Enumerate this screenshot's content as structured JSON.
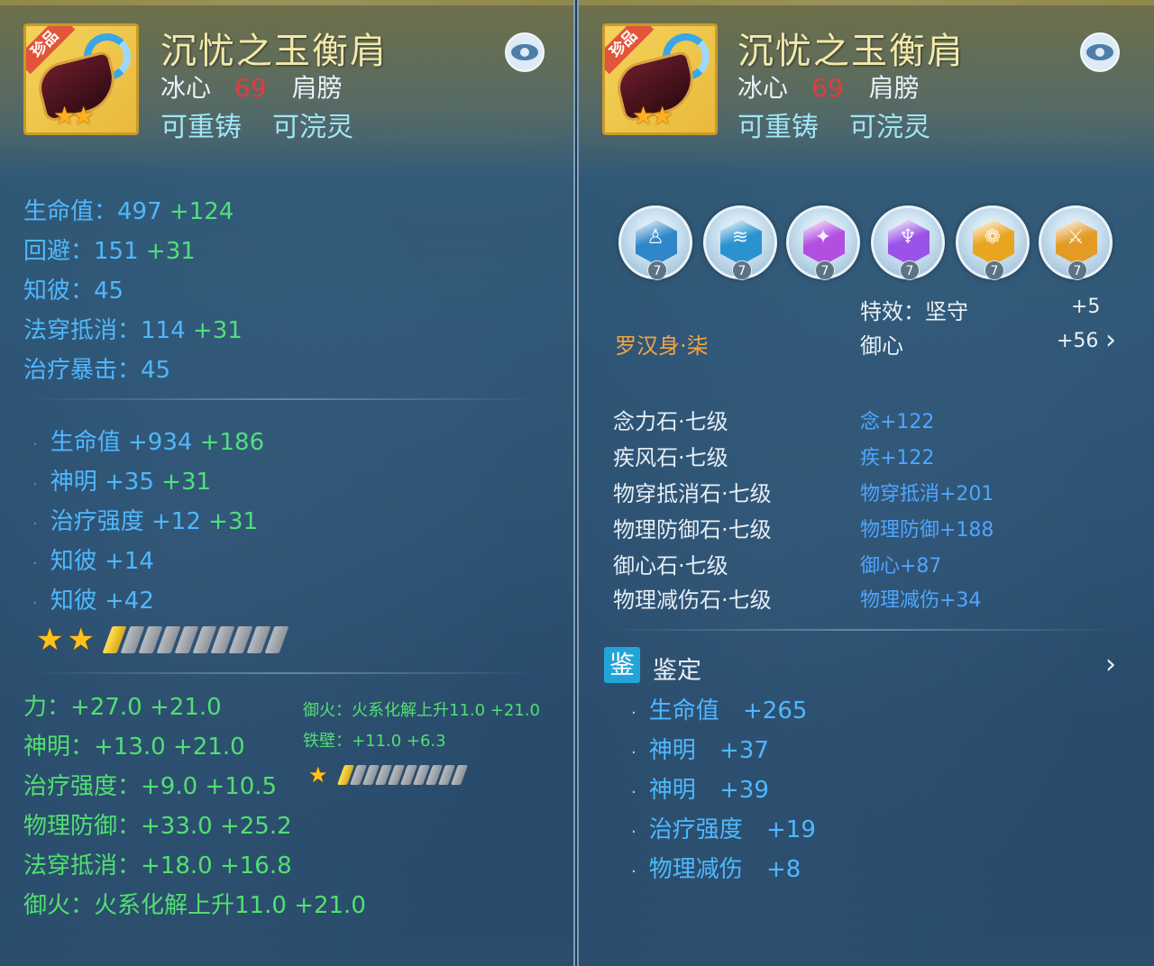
{
  "left": {
    "item": {
      "rarity_badge": "珍品",
      "name": "沉忧之玉衡肩",
      "school": "冰心",
      "level": "69",
      "slot": "肩膀",
      "tag_reforge": "可重铸",
      "tag_infuse": "可浣灵"
    },
    "base_stats": [
      {
        "label": "生命值：",
        "value": "497",
        "plus": "+124"
      },
      {
        "label": "回避：",
        "value": "151",
        "plus": "+31"
      },
      {
        "label": "知彼：",
        "value": "45",
        "plus": ""
      },
      {
        "label": "法穿抵消：",
        "value": "114",
        "plus": "+31"
      },
      {
        "label": "治疗暴击：",
        "value": "45",
        "plus": ""
      }
    ],
    "extra_stats": [
      {
        "label": "生命值",
        "value": "+934",
        "plus": "+186"
      },
      {
        "label": "神明",
        "value": "+35",
        "plus": "+31"
      },
      {
        "label": "治疗强度",
        "value": "+12",
        "plus": "+31"
      },
      {
        "label": "知彼",
        "value": "+14",
        "plus": ""
      },
      {
        "label": "知彼",
        "value": "+42",
        "plus": ""
      }
    ],
    "stars": 2,
    "bar_total": 10,
    "bar_filled": 1,
    "green_stats": [
      {
        "label": "力：",
        "value": "+27.0",
        "plus": "+21.0"
      },
      {
        "label": "神明：",
        "value": "+13.0",
        "plus": "+21.0"
      },
      {
        "label": "治疗强度：",
        "value": "+9.0",
        "plus": "+10.5"
      },
      {
        "label": "物理防御：",
        "value": "+33.0",
        "plus": "+25.2"
      },
      {
        "label": "法穿抵消：",
        "value": "+18.0",
        "plus": "+16.8"
      },
      {
        "label": "御火：",
        "value": "火系化解上升11.0",
        "plus": "+21.0"
      }
    ],
    "sub_card": {
      "line1": "御火：火系化解上升11.0 +21.0",
      "line2": "铁壁：+11.0 +6.3",
      "stars": 1,
      "bar_total": 10,
      "bar_filled": 1
    }
  },
  "right": {
    "item": {
      "rarity_badge": "珍品",
      "name": "沉忧之玉衡肩",
      "school": "冰心",
      "level": "69",
      "slot": "肩膀",
      "tag_reforge": "可重铸",
      "tag_infuse": "可浣灵"
    },
    "gems": [
      {
        "icon": "gem-blue-figure-icon",
        "color": "#2f86c9",
        "glyph": "♙",
        "level": "7"
      },
      {
        "icon": "gem-blue-wind-icon",
        "color": "#2a93cf",
        "glyph": "≋",
        "level": "7"
      },
      {
        "icon": "gem-purple-icon",
        "color": "#b24fe0",
        "glyph": "✦",
        "level": "7"
      },
      {
        "icon": "gem-violet-icon",
        "color": "#9a52e8",
        "glyph": "♆",
        "level": "7"
      },
      {
        "icon": "gem-gold-icon",
        "color": "#e7a521",
        "glyph": "❁",
        "level": "7"
      },
      {
        "icon": "gem-gold-sword-icon",
        "color": "#e39b26",
        "glyph": "⚔",
        "level": "7"
      }
    ],
    "set_name": "罗汉身·柒",
    "set_effect": {
      "label1": "特效：坚守",
      "val1": "+5",
      "label2": "御心",
      "val2": "+56"
    },
    "gem_rows": [
      {
        "name": "念力石·七级",
        "effect": "念+122"
      },
      {
        "name": "疾风石·七级",
        "effect": "疾+122"
      },
      {
        "name": "物穿抵消石·七级",
        "effect": "物穿抵消+201"
      },
      {
        "name": "物理防御石·七级",
        "effect": "物理防御+188"
      },
      {
        "name": "御心石·七级",
        "effect": "御心+87"
      },
      {
        "name": "物理减伤石·七级",
        "effect": "物理减伤+34"
      }
    ],
    "appraise": {
      "badge": "鉴",
      "title": "鉴定",
      "rows": [
        {
          "label": "生命值",
          "value": "+265"
        },
        {
          "label": "神明",
          "value": "+37"
        },
        {
          "label": "神明",
          "value": "+39"
        },
        {
          "label": "治疗强度",
          "value": "+19"
        },
        {
          "label": "物理减伤",
          "value": "+8"
        }
      ]
    }
  }
}
